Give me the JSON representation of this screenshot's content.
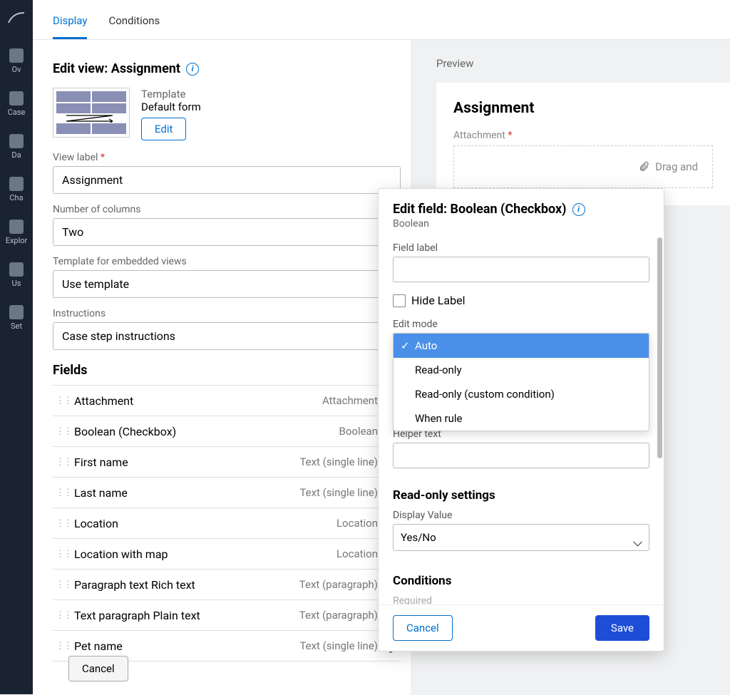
{
  "sidebar": {
    "items": [
      {
        "label": "Ov"
      },
      {
        "label": "Case"
      },
      {
        "label": "Da"
      },
      {
        "label": "Cha"
      },
      {
        "label": "Explor"
      },
      {
        "label": "Us"
      },
      {
        "label": "Set"
      }
    ]
  },
  "tabs": {
    "display": "Display",
    "conditions": "Conditions"
  },
  "editView": {
    "heading": "Edit view: Assignment",
    "templateLabel": "Template",
    "templateName": "Default form",
    "editButton": "Edit",
    "viewLabelLabel": "View label",
    "viewLabelValue": "Assignment",
    "numColsLabel": "Number of columns",
    "numColsValue": "Two",
    "embeddedTplLabel": "Template for embedded views",
    "embeddedTplValue": "Use template",
    "instructionsLabel": "Instructions",
    "instructionsValue": "Case step instructions",
    "fieldsHeading": "Fields",
    "fields": [
      {
        "name": "Attachment",
        "type": "Attachment"
      },
      {
        "name": "Boolean (Checkbox)",
        "type": "Boolean"
      },
      {
        "name": "First name",
        "type": "Text (single line)"
      },
      {
        "name": "Last name",
        "type": "Text (single line)"
      },
      {
        "name": "Location",
        "type": "Location"
      },
      {
        "name": "Location with map",
        "type": "Location"
      },
      {
        "name": "Paragraph text Rich text",
        "type": "Text (paragraph)"
      },
      {
        "name": "Text paragraph Plain text",
        "type": "Text (paragraph)"
      },
      {
        "name": "Pet name",
        "type": "Text (single line)"
      }
    ]
  },
  "preview": {
    "label": "Preview",
    "title": "Assignment",
    "attachLabel": "Attachment",
    "dropzone": "Drag and"
  },
  "panel": {
    "title": "Edit field: Boolean (Checkbox)",
    "sub": "Boolean",
    "fieldLabelLabel": "Field label",
    "fieldLabelValue": "",
    "hideLabel": "Hide Label",
    "editModeLabel": "Edit mode",
    "editModeOptions": [
      "Auto",
      "Read-only",
      "Read-only (custom condition)",
      "When rule"
    ],
    "editModeSelected": "Auto",
    "booleanCheckboxValue": "Boolean (Checkbox)",
    "helperTextLabel": "Helper text",
    "helperTextValue": "",
    "readOnlySettings": "Read-only settings",
    "displayValueLabel": "Display Value",
    "displayValue": "Yes/No",
    "conditionsHeading": "Conditions",
    "requiredLabel": "Required",
    "cancel": "Cancel",
    "save": "Save"
  },
  "footer": {
    "cancel": "Cancel"
  }
}
